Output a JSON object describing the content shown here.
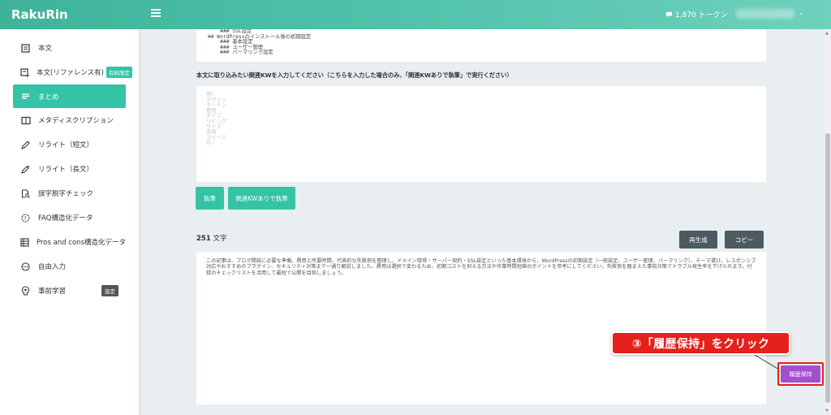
{
  "header": {
    "logo_text": "RakuRin",
    "tokens_label": "1,870 トークン",
    "accent": "#3fb39a"
  },
  "sidebar": {
    "items": [
      {
        "label": "本文",
        "icon": "document-icon"
      },
      {
        "label": "本文(リファレンス有)",
        "icon": "document-add-icon",
        "badge": "有料限定"
      },
      {
        "label": "まとめ",
        "icon": "list-icon",
        "active": true
      },
      {
        "label": "メタディスクリプション",
        "icon": "panel-icon"
      },
      {
        "label": "リライト（短文）",
        "icon": "pencil-icon"
      },
      {
        "label": "リライト（長文）",
        "icon": "magic-pencil-icon"
      },
      {
        "label": "誤字脱字チェック",
        "icon": "file-search-icon"
      },
      {
        "label": "FAQ構造化データ",
        "icon": "question-icon"
      },
      {
        "label": "Pros and cons構造化データ",
        "icon": "table-icon"
      },
      {
        "label": "自由入力",
        "icon": "chat-icon"
      },
      {
        "label": "事前学習",
        "icon": "brain-icon",
        "badge": "設定"
      }
    ]
  },
  "main": {
    "markdown_lines": [
      "    ### SSL設定",
      "",
      "## WordPressのインストール後の初期設定",
      "    ### 基本設定",
      "    ### ユーザー管理",
      "    ### パーマリンク設定"
    ],
    "kw_label": "本文に取り込みたい関連KWを入力してください（こちらを入力した場合のみ、「関連KWありで執筆」で実行ください）",
    "kw_placeholder_lines": [
      "例）",
      "デザイン",
      "キッチン",
      "費用",
      "タイプ",
      "リビング",
      "サイズ",
      "収納",
      "スペース",
      "広く"
    ],
    "exec_button": "執筆",
    "exec_kw_button": "関連KWありで執筆",
    "char_count": "251",
    "char_unit": "文字",
    "regen_button": "再生成",
    "copy_button": "コピー",
    "result_text": "この記事は、ブログ開設に必要な準備、費用と所要時間、代表的な失敗例を整理し、ドメイン取得・サーバー契約・SSL設定といった基本環境から、WordPressの初期設定（一般設定、ユーザー管理、パーマリンク）、テーマ選び、レスポンシブ対応やおすすめのプラグイン、セキュリティ対策まで一通り解説しました。費用は選択で変わるため、初期コストを抑える方法や作業時間短縮のポイントを参考にしてください。失敗例を踏まえた事前対策でトラブル発生率を下げられます。付録のチェックリストを活用して最短で公開を目指しましょう。",
    "history_button": "履歴保持"
  },
  "annotation": {
    "callout_text": "③「履歴保持」をクリック",
    "color": "#e6201c"
  }
}
